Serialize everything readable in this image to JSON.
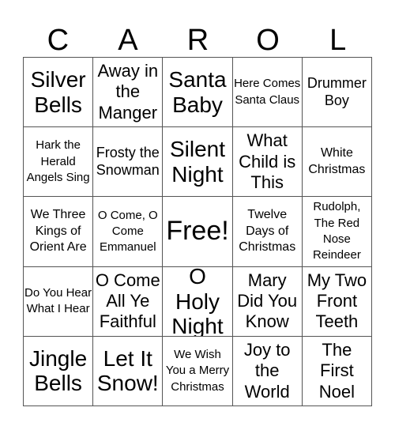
{
  "header": {
    "letters": [
      "C",
      "A",
      "R",
      "O",
      "L"
    ]
  },
  "cells": [
    {
      "text": "Silver Bells",
      "size": "s1"
    },
    {
      "text": "Away in the Manger",
      "size": "s2"
    },
    {
      "text": "Santa Baby",
      "size": "s1"
    },
    {
      "text": "Here Comes Santa Claus",
      "size": "s5"
    },
    {
      "text": "Drummer Boy",
      "size": "s3"
    },
    {
      "text": "Hark the Herald Angels Sing",
      "size": "s5"
    },
    {
      "text": "Frosty the Snowman",
      "size": "s3"
    },
    {
      "text": "Silent Night",
      "size": "s1"
    },
    {
      "text": "What Child is This",
      "size": "s2"
    },
    {
      "text": "White Christmas",
      "size": "s4"
    },
    {
      "text": "We Three Kings of Orient Are",
      "size": "s4"
    },
    {
      "text": "O Come, O Come Emmanuel",
      "size": "s5"
    },
    {
      "text": "Free!",
      "size": "free"
    },
    {
      "text": "Twelve Days of Christmas",
      "size": "s4"
    },
    {
      "text": "Rudolph, The Red Nose Reindeer",
      "size": "s5"
    },
    {
      "text": "Do You Hear What I Hear",
      "size": "s5"
    },
    {
      "text": "O Come All Ye Faithful",
      "size": "s2"
    },
    {
      "text": "O Holy Night",
      "size": "s1"
    },
    {
      "text": "Mary Did You Know",
      "size": "s2"
    },
    {
      "text": "My Two Front Teeth",
      "size": "s2"
    },
    {
      "text": "Jingle Bells",
      "size": "s1"
    },
    {
      "text": "Let It Snow!",
      "size": "s1"
    },
    {
      "text": "We Wish You a Merry Christmas",
      "size": "s5"
    },
    {
      "text": "Joy to the World",
      "size": "s2"
    },
    {
      "text": "The First Noel",
      "size": "s2"
    }
  ]
}
